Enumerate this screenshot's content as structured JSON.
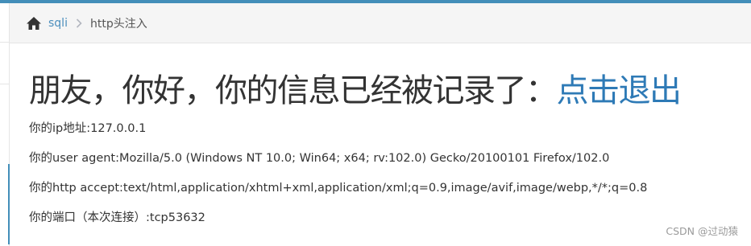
{
  "breadcrumb": {
    "home_icon": "home-icon",
    "section_label": "sqli",
    "current_label": "http头注入"
  },
  "main": {
    "headline_prefix": "朋友，你好，你的信息已经被记录了：",
    "logout_label": "点击退出",
    "ip_line": "你的ip地址:127.0.0.1",
    "user_agent_line": "你的user agent:Mozilla/5.0 (Windows NT 10.0; Win64; x64; rv:102.0) Gecko/20100101 Firefox/102.0",
    "accept_line": "你的http accept:text/html,application/xhtml+xml,application/xml;q=0.9,image/avif,image/webp,*/*;q=0.8",
    "port_line": "你的端口（本次连接）:tcp53632"
  },
  "watermark": "CSDN @过动猿",
  "colors": {
    "accent": "#438eb9",
    "link": "#2e7ab6"
  }
}
